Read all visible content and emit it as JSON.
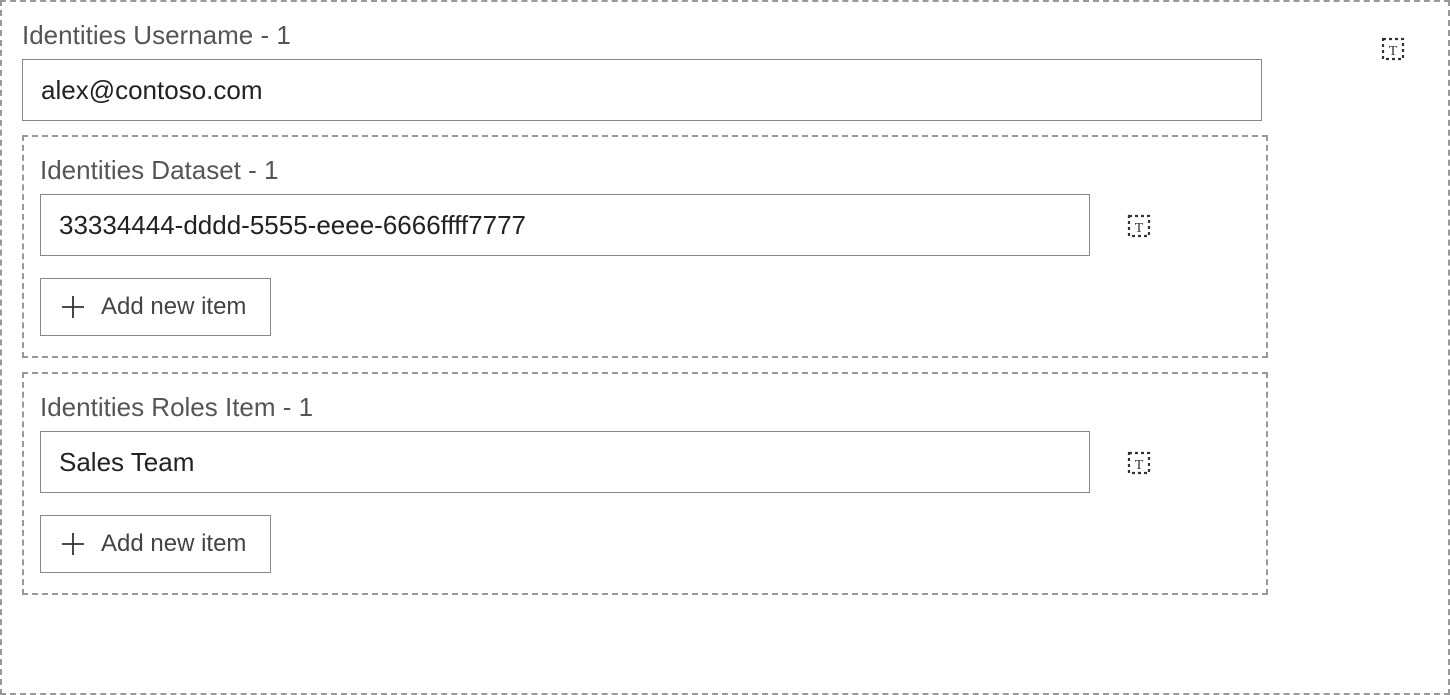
{
  "sections": {
    "username": {
      "label": "Identities Username - 1",
      "value": "alex@contoso.com"
    },
    "dataset": {
      "label": "Identities Dataset - 1",
      "value": "33334444-dddd-5555-eeee-6666ffff7777",
      "add_label": "Add new item"
    },
    "roles": {
      "label": "Identities Roles Item - 1",
      "value": "Sales Team",
      "add_label": "Add new item"
    }
  }
}
